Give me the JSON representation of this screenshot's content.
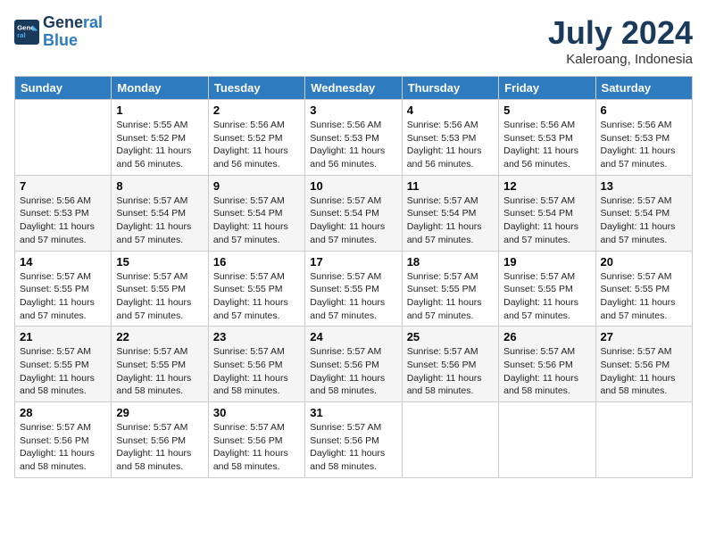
{
  "header": {
    "logo_line1": "General",
    "logo_line2": "Blue",
    "month_year": "July 2024",
    "location": "Kaleroang, Indonesia"
  },
  "weekdays": [
    "Sunday",
    "Monday",
    "Tuesday",
    "Wednesday",
    "Thursday",
    "Friday",
    "Saturday"
  ],
  "weeks": [
    [
      {
        "day": "",
        "info": ""
      },
      {
        "day": "1",
        "info": "Sunrise: 5:55 AM\nSunset: 5:52 PM\nDaylight: 11 hours\nand 56 minutes."
      },
      {
        "day": "2",
        "info": "Sunrise: 5:56 AM\nSunset: 5:52 PM\nDaylight: 11 hours\nand 56 minutes."
      },
      {
        "day": "3",
        "info": "Sunrise: 5:56 AM\nSunset: 5:53 PM\nDaylight: 11 hours\nand 56 minutes."
      },
      {
        "day": "4",
        "info": "Sunrise: 5:56 AM\nSunset: 5:53 PM\nDaylight: 11 hours\nand 56 minutes."
      },
      {
        "day": "5",
        "info": "Sunrise: 5:56 AM\nSunset: 5:53 PM\nDaylight: 11 hours\nand 56 minutes."
      },
      {
        "day": "6",
        "info": "Sunrise: 5:56 AM\nSunset: 5:53 PM\nDaylight: 11 hours\nand 57 minutes."
      }
    ],
    [
      {
        "day": "7",
        "info": "Sunrise: 5:56 AM\nSunset: 5:53 PM\nDaylight: 11 hours\nand 57 minutes."
      },
      {
        "day": "8",
        "info": "Sunrise: 5:57 AM\nSunset: 5:54 PM\nDaylight: 11 hours\nand 57 minutes."
      },
      {
        "day": "9",
        "info": "Sunrise: 5:57 AM\nSunset: 5:54 PM\nDaylight: 11 hours\nand 57 minutes."
      },
      {
        "day": "10",
        "info": "Sunrise: 5:57 AM\nSunset: 5:54 PM\nDaylight: 11 hours\nand 57 minutes."
      },
      {
        "day": "11",
        "info": "Sunrise: 5:57 AM\nSunset: 5:54 PM\nDaylight: 11 hours\nand 57 minutes."
      },
      {
        "day": "12",
        "info": "Sunrise: 5:57 AM\nSunset: 5:54 PM\nDaylight: 11 hours\nand 57 minutes."
      },
      {
        "day": "13",
        "info": "Sunrise: 5:57 AM\nSunset: 5:54 PM\nDaylight: 11 hours\nand 57 minutes."
      }
    ],
    [
      {
        "day": "14",
        "info": "Sunrise: 5:57 AM\nSunset: 5:55 PM\nDaylight: 11 hours\nand 57 minutes."
      },
      {
        "day": "15",
        "info": "Sunrise: 5:57 AM\nSunset: 5:55 PM\nDaylight: 11 hours\nand 57 minutes."
      },
      {
        "day": "16",
        "info": "Sunrise: 5:57 AM\nSunset: 5:55 PM\nDaylight: 11 hours\nand 57 minutes."
      },
      {
        "day": "17",
        "info": "Sunrise: 5:57 AM\nSunset: 5:55 PM\nDaylight: 11 hours\nand 57 minutes."
      },
      {
        "day": "18",
        "info": "Sunrise: 5:57 AM\nSunset: 5:55 PM\nDaylight: 11 hours\nand 57 minutes."
      },
      {
        "day": "19",
        "info": "Sunrise: 5:57 AM\nSunset: 5:55 PM\nDaylight: 11 hours\nand 57 minutes."
      },
      {
        "day": "20",
        "info": "Sunrise: 5:57 AM\nSunset: 5:55 PM\nDaylight: 11 hours\nand 57 minutes."
      }
    ],
    [
      {
        "day": "21",
        "info": "Sunrise: 5:57 AM\nSunset: 5:55 PM\nDaylight: 11 hours\nand 58 minutes."
      },
      {
        "day": "22",
        "info": "Sunrise: 5:57 AM\nSunset: 5:55 PM\nDaylight: 11 hours\nand 58 minutes."
      },
      {
        "day": "23",
        "info": "Sunrise: 5:57 AM\nSunset: 5:56 PM\nDaylight: 11 hours\nand 58 minutes."
      },
      {
        "day": "24",
        "info": "Sunrise: 5:57 AM\nSunset: 5:56 PM\nDaylight: 11 hours\nand 58 minutes."
      },
      {
        "day": "25",
        "info": "Sunrise: 5:57 AM\nSunset: 5:56 PM\nDaylight: 11 hours\nand 58 minutes."
      },
      {
        "day": "26",
        "info": "Sunrise: 5:57 AM\nSunset: 5:56 PM\nDaylight: 11 hours\nand 58 minutes."
      },
      {
        "day": "27",
        "info": "Sunrise: 5:57 AM\nSunset: 5:56 PM\nDaylight: 11 hours\nand 58 minutes."
      }
    ],
    [
      {
        "day": "28",
        "info": "Sunrise: 5:57 AM\nSunset: 5:56 PM\nDaylight: 11 hours\nand 58 minutes."
      },
      {
        "day": "29",
        "info": "Sunrise: 5:57 AM\nSunset: 5:56 PM\nDaylight: 11 hours\nand 58 minutes."
      },
      {
        "day": "30",
        "info": "Sunrise: 5:57 AM\nSunset: 5:56 PM\nDaylight: 11 hours\nand 58 minutes."
      },
      {
        "day": "31",
        "info": "Sunrise: 5:57 AM\nSunset: 5:56 PM\nDaylight: 11 hours\nand 58 minutes."
      },
      {
        "day": "",
        "info": ""
      },
      {
        "day": "",
        "info": ""
      },
      {
        "day": "",
        "info": ""
      }
    ]
  ]
}
